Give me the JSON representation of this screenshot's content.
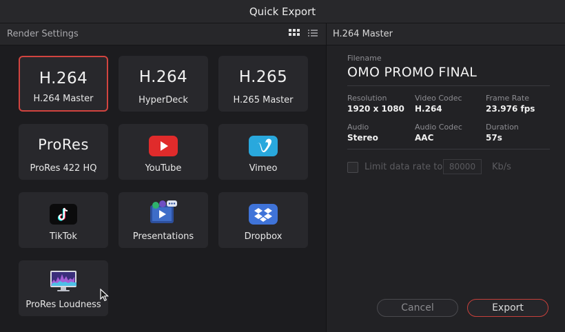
{
  "window": {
    "title": "Quick Export"
  },
  "left_panel": {
    "header": "Render Settings",
    "view_grid_icon": "grid-view-icon",
    "view_list_icon": "list-view-icon",
    "presets": [
      {
        "big": "H.264",
        "label": "H.264 Master",
        "selected": true
      },
      {
        "big": "H.264",
        "label": "HyperDeck"
      },
      {
        "big": "H.265",
        "label": "H.265 Master"
      },
      {
        "big": "ProRes",
        "label": "ProRes 422 HQ"
      },
      {
        "icon": "youtube-icon",
        "label": "YouTube"
      },
      {
        "icon": "vimeo-icon",
        "label": "Vimeo"
      },
      {
        "icon": "tiktok-icon",
        "label": "TikTok"
      },
      {
        "icon": "presentations-icon",
        "label": "Presentations"
      },
      {
        "icon": "dropbox-icon",
        "label": "Dropbox"
      },
      {
        "icon": "loudness-monitor-icon",
        "label": "ProRes Loudness"
      }
    ]
  },
  "right_panel": {
    "header": "H.264 Master",
    "filename_label": "Filename",
    "filename": "OMO PROMO FINAL",
    "fields": {
      "resolution_label": "Resolution",
      "resolution": "1920 x 1080",
      "video_codec_label": "Video Codec",
      "video_codec": "H.264",
      "frame_rate_label": "Frame Rate",
      "frame_rate": "23.976 fps",
      "audio_label": "Audio",
      "audio": "Stereo",
      "audio_codec_label": "Audio Codec",
      "audio_codec": "AAC",
      "duration_label": "Duration",
      "duration": "57s"
    },
    "limit_label": "Limit data rate to",
    "limit_value": "80000",
    "limit_unit": "Kb/s",
    "limit_checked": false,
    "cancel_label": "Cancel",
    "export_label": "Export"
  },
  "colors": {
    "accent": "#d2443f",
    "youtube": "#e02b2b",
    "vimeo": "#29a8dd",
    "dropbox": "#3f73d8"
  }
}
